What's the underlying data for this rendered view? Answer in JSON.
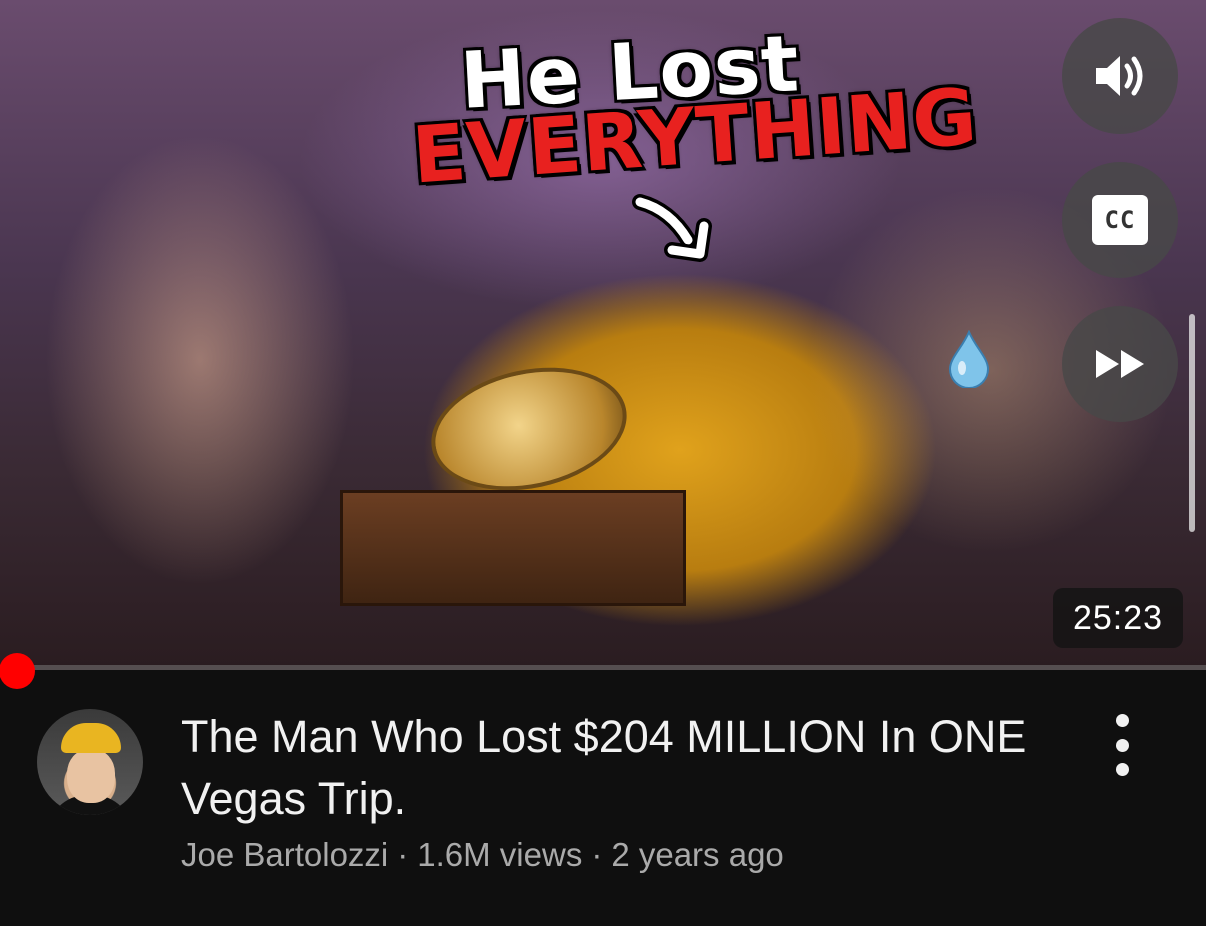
{
  "video": {
    "thumbnail_text_line1": "He Lost",
    "thumbnail_text_line2": "EVERYTHING",
    "duration": "25:23",
    "progress_fraction": 0.01,
    "controls": {
      "mute_icon": "speaker-icon",
      "cc_label": "CC",
      "ff_icon": "fast-forward-icon"
    }
  },
  "meta": {
    "title": "The Man Who Lost $204 MILLION In ONE Vegas Trip.",
    "channel": "Joe Bartolozzi",
    "separator": "·",
    "views": "1.6M views",
    "age": "2 years ago"
  },
  "colors": {
    "background": "#0f0f0f",
    "accent_red": "#ff0000",
    "title_text": "#f1f1f1",
    "secondary_text": "#aaaaaa"
  }
}
